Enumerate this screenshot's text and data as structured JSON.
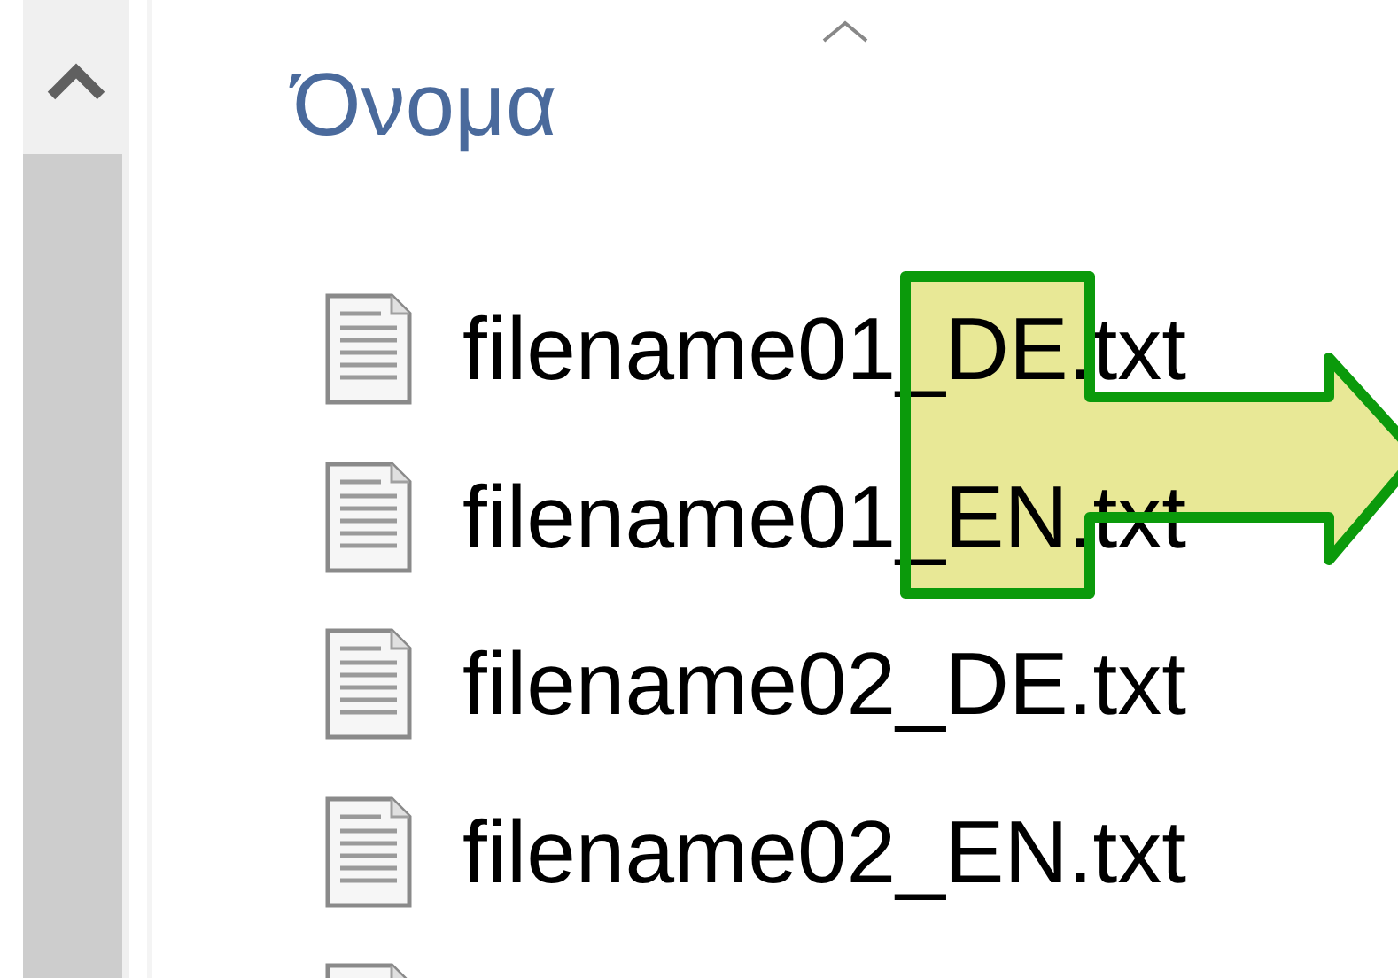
{
  "column_header": {
    "label": "Όνομα",
    "sort_ascending": true
  },
  "files": [
    {
      "name": "filename01_DE.txt"
    },
    {
      "name": "filename01_EN.txt"
    },
    {
      "name": "filename02_DE.txt"
    },
    {
      "name": "filename02_EN.txt"
    }
  ]
}
